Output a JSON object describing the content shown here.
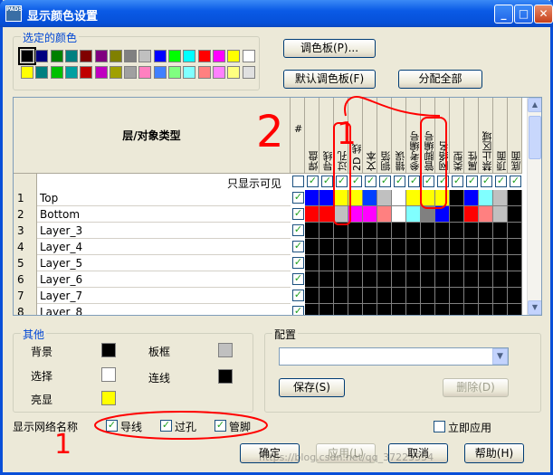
{
  "window": {
    "title": "显示颜色设置",
    "app_icon_text": "PADS"
  },
  "selected_colors": {
    "label": "选定的颜色",
    "row1": [
      "#000000",
      "#000080",
      "#008000",
      "#008080",
      "#800000",
      "#800080",
      "#808000",
      "#808080",
      "#c0c0c0",
      "#0000ff",
      "#00ff00",
      "#00ffff",
      "#ff0000",
      "#ff00ff",
      "#ffff00",
      "#ffffff"
    ],
    "row2": [
      "#ffff00",
      "#008080",
      "#00c000",
      "#00a0a0",
      "#c00000",
      "#c000c0",
      "#a0a000",
      "#a0a0a0",
      "#ff80c0",
      "#4080ff",
      "#80ff80",
      "#80ffff",
      "#ff8080",
      "#ff80ff",
      "#ffff80",
      "#e0e0e0"
    ]
  },
  "buttons": {
    "palette": "调色板(P)...",
    "default_palette": "默认调色板(F)",
    "assign_all": "分配全部",
    "save": "保存(S)",
    "delete": "删除(D)",
    "ok": "确定",
    "apply": "应用(L)",
    "cancel": "取消",
    "help": "帮助(H)"
  },
  "table": {
    "type_header": "层/对象类型",
    "hash_header": "#",
    "show_visible_label": "只显示可见",
    "columns": [
      "焊盘",
      "导线",
      "过孔",
      "2D 线",
      "文本",
      "铜箔",
      "错误",
      "参考编号",
      "管脚编号",
      "网络名",
      "类型",
      "属性",
      "禁止区域",
      "顶面",
      "底面"
    ],
    "rows": [
      {
        "num": "1",
        "name": "Top",
        "colors": [
          "#0000ff",
          "#0000ff",
          "#ffff00",
          "#ffff00",
          "#0040ff",
          "#c0c0c0",
          "#ffffff",
          "#ffff00",
          "#ffff00",
          "#ffff00",
          "#000000",
          "#0000ff",
          "#80ffff",
          "#c0c0c0",
          "#000000"
        ]
      },
      {
        "num": "2",
        "name": "Bottom",
        "colors": [
          "#ff0000",
          "#ff0000",
          "#c0c0c0",
          "#ff00ff",
          "#ff00ff",
          "#ff8080",
          "#ffffff",
          "#80ffff",
          "#808080",
          "#0000ff",
          "#000000",
          "#ff0000",
          "#ff8080",
          "#c0c0c0",
          "#000000"
        ]
      },
      {
        "num": "3",
        "name": "Layer_3",
        "colors": []
      },
      {
        "num": "4",
        "name": "Layer_4",
        "colors": []
      },
      {
        "num": "5",
        "name": "Layer_5",
        "colors": []
      },
      {
        "num": "6",
        "name": "Layer_6",
        "colors": []
      },
      {
        "num": "7",
        "name": "Layer_7",
        "colors": []
      },
      {
        "num": "8",
        "name": "Layer_8",
        "colors": []
      }
    ]
  },
  "other": {
    "label": "其他",
    "background": {
      "label": "背景",
      "color": "#000000"
    },
    "board_outline": {
      "label": "板框",
      "color": "#c0c0c0"
    },
    "selection": {
      "label": "选择",
      "color": "#ffffff"
    },
    "connection": {
      "label": "连线",
      "color": "#000000"
    },
    "highlight": {
      "label": "亮显",
      "color": "#ffff00"
    }
  },
  "config": {
    "label": "配置",
    "value": ""
  },
  "net_names": {
    "label": "显示网络名称",
    "traces": "导线",
    "vias": "过孔",
    "pins": "管脚"
  },
  "apply_now": "立即应用",
  "annotations": [
    "1",
    "2"
  ],
  "watermark": "https://blog.csdn.net/qq_37225554"
}
